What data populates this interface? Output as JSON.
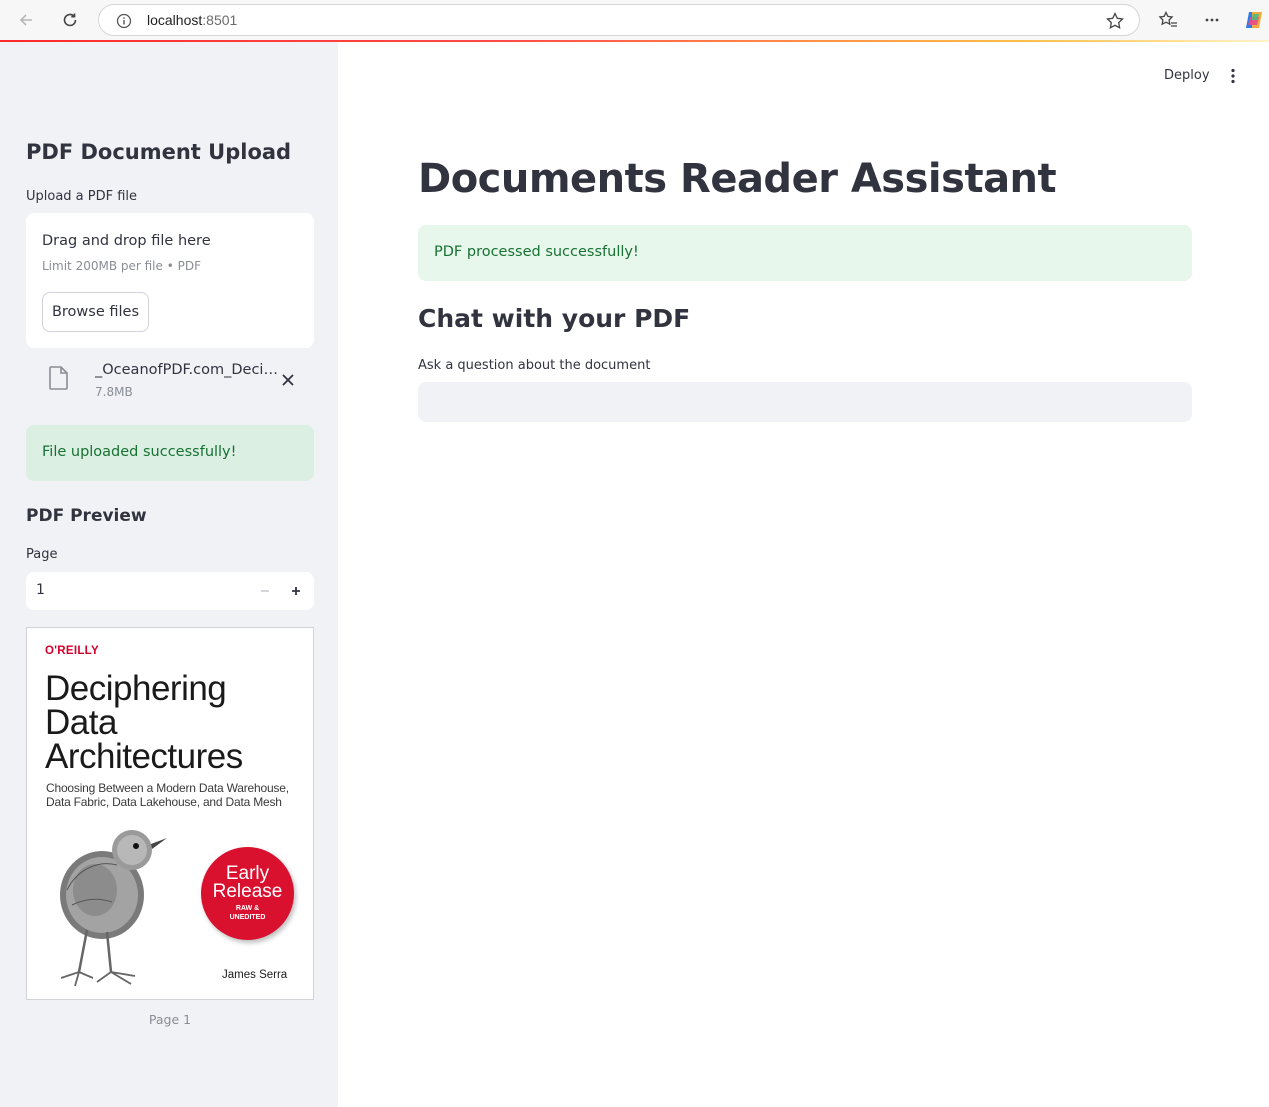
{
  "browser": {
    "host": "localhost",
    "port": ":8501"
  },
  "sidebar": {
    "title": "PDF Document Upload",
    "uploader": {
      "label": "Upload a PDF file",
      "drag_text": "Drag and drop file here",
      "limit_text": "Limit 200MB per file • PDF",
      "browse_label": "Browse files"
    },
    "uploaded_file": {
      "name": "_OceanofPDF.com_Deciphering_Data_Architectures.pdf",
      "size": "7.8MB"
    },
    "upload_success": "File uploaded successfully!",
    "preview": {
      "title": "PDF Preview",
      "page_label": "Page",
      "page_value": "1",
      "caption": "Page 1",
      "cover": {
        "brand": "O'REILLY",
        "title_lines": [
          "Deciphering",
          "Data",
          "Architectures"
        ],
        "subtitle_lines": [
          "Choosing Between a Modern Data Warehouse,",
          "Data Fabric, Data Lakehouse, and Data Mesh"
        ],
        "badge_lines": [
          "Early",
          "Release",
          "RAW &",
          "UNEDITED"
        ],
        "author": "James Serra"
      }
    }
  },
  "header": {
    "deploy_label": "Deploy"
  },
  "main": {
    "title": "Documents Reader Assistant",
    "processed_message": "PDF processed successfully!",
    "chat_title": "Chat with your PDF",
    "question_label": "Ask a question about the document",
    "question_value": ""
  },
  "colors": {
    "sidebar_bg": "#f0f2f6",
    "success_text": "#177233",
    "success_bg": "#e8f7ec",
    "badge_red": "#d9112f"
  }
}
